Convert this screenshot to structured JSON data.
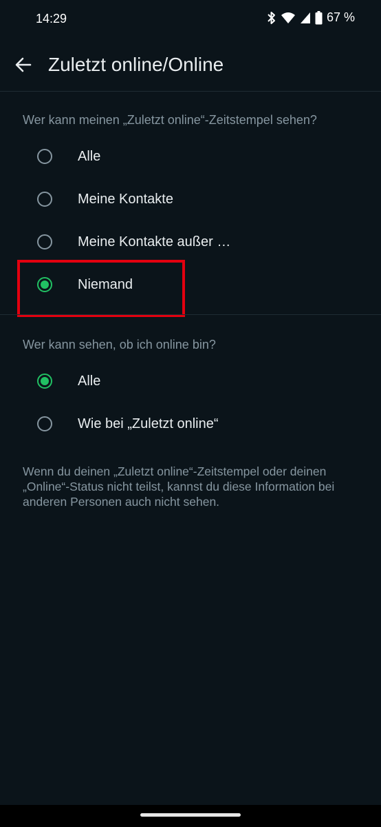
{
  "status_bar": {
    "time": "14:29",
    "battery": "67 %",
    "icons": [
      "bluetooth-icon",
      "wifi-icon",
      "signal-icon",
      "battery-icon"
    ]
  },
  "header": {
    "back_icon": "arrow-left-icon",
    "title": "Zuletzt online/Online"
  },
  "last_seen": {
    "heading": "Wer kann meinen „Zuletzt online“-Zeitstempel sehen?",
    "options": [
      {
        "label": "Alle",
        "selected": false
      },
      {
        "label": "Meine Kontakte",
        "selected": false
      },
      {
        "label": "Meine Kontakte außer …",
        "selected": false
      },
      {
        "label": "Niemand",
        "selected": true
      }
    ]
  },
  "online": {
    "heading": "Wer kann sehen, ob ich online bin?",
    "options": [
      {
        "label": "Alle",
        "selected": true
      },
      {
        "label": "Wie bei „Zuletzt online“",
        "selected": false
      }
    ]
  },
  "footnote": "Wenn du deinen „Zuletzt online“-Zeitstempel oder deinen „Online“-Status nicht teilst, kannst du diese Information bei anderen Personen auch nicht sehen.",
  "colors": {
    "background": "#0b141a",
    "accent": "#21c063",
    "highlight": "#e3000f",
    "secondary_text": "#8696a0"
  }
}
